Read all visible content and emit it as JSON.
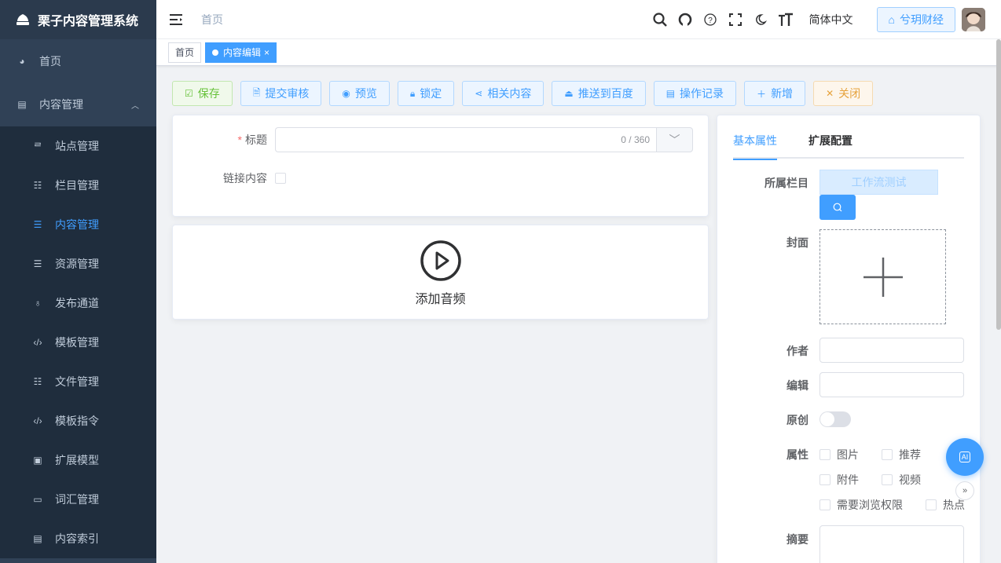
{
  "app": {
    "title": "栗子内容管理系统"
  },
  "sidebar": {
    "items": [
      {
        "label": "首页",
        "icon": "dashboard-icon"
      },
      {
        "label": "内容管理",
        "icon": "document-icon"
      }
    ],
    "sub_items": [
      {
        "label": "站点管理",
        "icon": "site-icon"
      },
      {
        "label": "栏目管理",
        "icon": "tree-icon"
      },
      {
        "label": "内容管理",
        "icon": "list-icon",
        "active": true
      },
      {
        "label": "资源管理",
        "icon": "list-icon"
      },
      {
        "label": "发布通道",
        "icon": "publish-icon"
      },
      {
        "label": "模板管理",
        "icon": "code-icon"
      },
      {
        "label": "文件管理",
        "icon": "tree-icon"
      },
      {
        "label": "模板指令",
        "icon": "code-icon"
      },
      {
        "label": "扩展模型",
        "icon": "model-icon"
      },
      {
        "label": "词汇管理",
        "icon": "word-icon"
      },
      {
        "label": "内容索引",
        "icon": "document-icon"
      }
    ]
  },
  "header": {
    "breadcrumb": "首页",
    "language": "简体中文",
    "site_button": "兮玥财经"
  },
  "tags": [
    {
      "label": "首页",
      "active": false
    },
    {
      "label": "内容编辑",
      "active": true
    }
  ],
  "toolbar": {
    "save": "保存",
    "submit_review": "提交审核",
    "preview": "预览",
    "lock": "锁定",
    "related": "相关内容",
    "push_baidu": "推送到百度",
    "op_log": "操作记录",
    "add": "新增",
    "close": "关闭"
  },
  "form": {
    "title_label": "标题",
    "title_value": "",
    "title_count": "0 / 360",
    "link_label": "链接内容",
    "add_audio": "添加音频"
  },
  "panel": {
    "tabs": [
      "基本属性",
      "扩展配置"
    ],
    "catalog_label": "所属栏目",
    "catalog_value": "工作流测试",
    "cover_label": "封面",
    "author_label": "作者",
    "author_value": "",
    "editor_label": "编辑",
    "editor_value": "",
    "original_label": "原创",
    "original_on": false,
    "attr_label": "属性",
    "attrs": [
      "图片",
      "推荐",
      "附件",
      "视频",
      "需要浏览权限",
      "热点"
    ],
    "summary_label": "摘要"
  },
  "colors": {
    "primary": "#409eff",
    "sidebar": "#304156",
    "success": "#67c23a",
    "warning": "#e6a23c"
  }
}
